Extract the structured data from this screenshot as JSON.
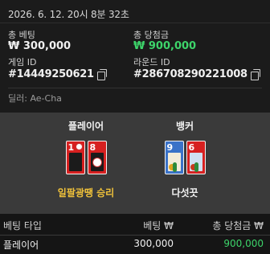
{
  "round": {
    "datetime": "2026. 6. 12. 20시 8분 32초",
    "total_bet_label": "총 베팅",
    "total_bet_value": "₩ 300,000",
    "total_win_label": "총 당첨금",
    "total_win_value": "₩ 900,000",
    "game_id_label": "게임 ID",
    "game_id_value": "#14449250621",
    "round_id_label": "라운드 ID",
    "round_id_value": "#286708290221008",
    "dealer": "딜러: Ae-Cha"
  },
  "result": {
    "player": {
      "title": "플레이어",
      "cards": [
        {
          "number": "1",
          "color": "#d72020",
          "icon": "crane-card-icon"
        },
        {
          "number": "8",
          "color": "#d72020",
          "icon": "moon-card-icon"
        }
      ],
      "outcome": "일팔광땡 승리",
      "outcome_color": "#f0c23a"
    },
    "banker": {
      "title": "뱅커",
      "cards": [
        {
          "number": "9",
          "color": "#3a72c8",
          "icon": "chrysanthemum-card-icon"
        },
        {
          "number": "6",
          "color": "#d72020",
          "icon": "peony-card-icon"
        }
      ],
      "outcome": "다섯끗",
      "outcome_color": "#f2f2f2"
    }
  },
  "bets_table": {
    "headers": [
      "베팅 타입",
      "베팅 ₩",
      "총 당첨금 ₩"
    ],
    "rows": [
      [
        "플레이어",
        "300,000",
        "900,000"
      ]
    ]
  }
}
